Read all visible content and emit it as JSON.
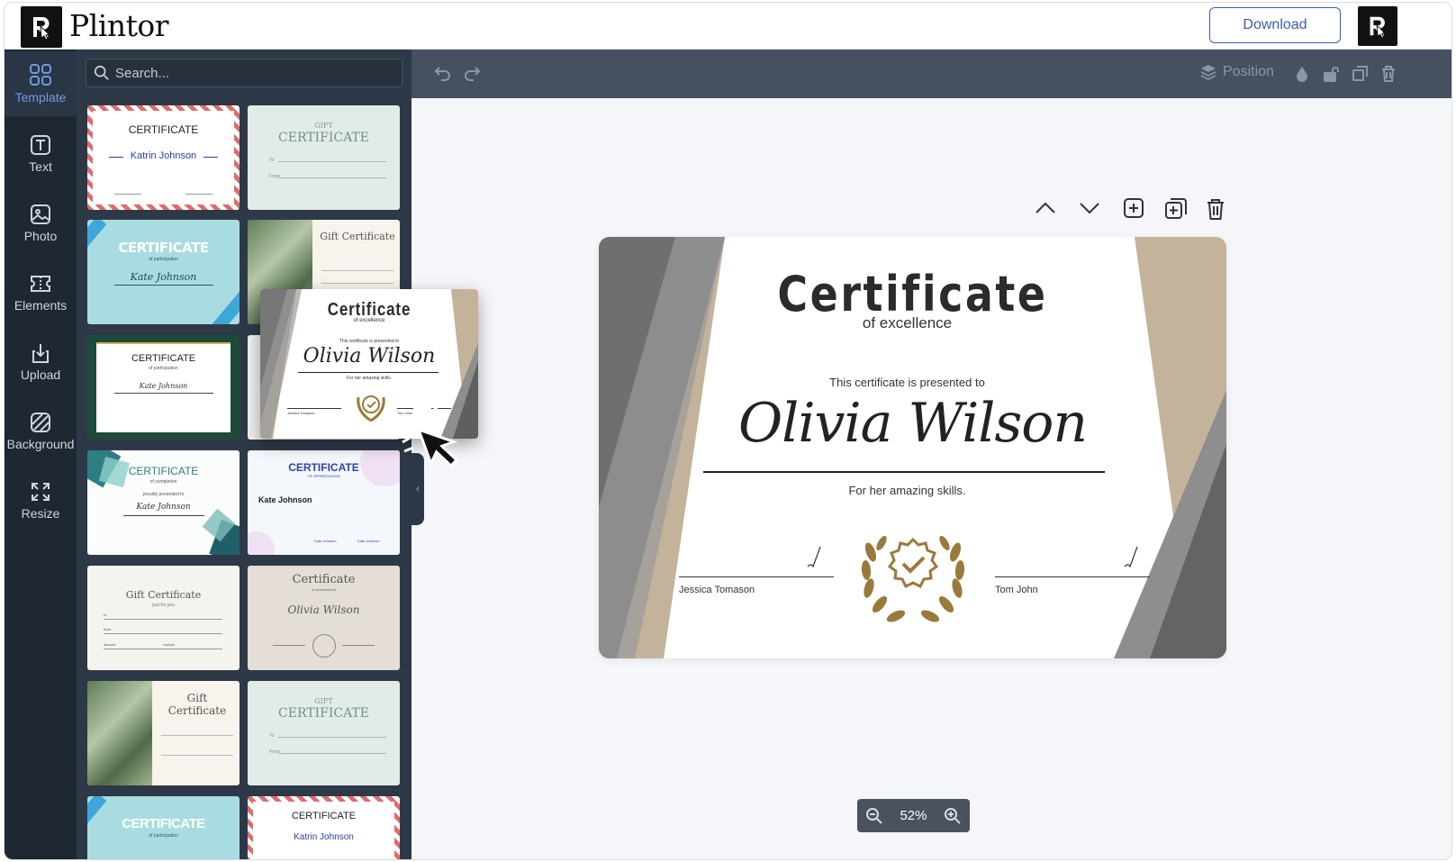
{
  "app": {
    "name": "Plintor",
    "download_label": "Download"
  },
  "sidebar": {
    "items": [
      {
        "label": "Template",
        "icon": "grid-icon",
        "active": true
      },
      {
        "label": "Text",
        "icon": "text-icon"
      },
      {
        "label": "Photo",
        "icon": "photo-icon"
      },
      {
        "label": "Elements",
        "icon": "elements-icon"
      },
      {
        "label": "Upload",
        "icon": "upload-icon"
      },
      {
        "label": "Background",
        "icon": "background-icon"
      },
      {
        "label": "Resize",
        "icon": "resize-icon"
      }
    ]
  },
  "search": {
    "placeholder": "Search..."
  },
  "templates": [
    {
      "title": "CERTIFICATE",
      "name": "Katrin Johnson"
    },
    {
      "subtitle": "GIFT",
      "title": "CERTIFICATE",
      "to": "To",
      "from": "From"
    },
    {
      "title": "CERTIFICATE",
      "subtitle": "of participation",
      "name": "Kate Johnson"
    },
    {
      "title": "Gift Certificate"
    },
    {
      "title": "CERTIFICATE",
      "subtitle": "of participation",
      "name": "Kate Johnson"
    },
    {},
    {
      "title": "CERTIFICATE",
      "subtitle": "of completion",
      "presented": "proudly presented to",
      "name": "Kate Johnson"
    },
    {
      "title": "CERTIFICATE",
      "subtitle": "OF APPRECIATION",
      "name": "Kate Johnson",
      "sign1": "Kate Johnson",
      "sign2": "Kate Johnson"
    },
    {
      "title": "Gift Certificate",
      "subtitle": "just for you",
      "to": "to",
      "from": "from",
      "amount": "amount",
      "expires": "expires"
    },
    {
      "title": "Certificate",
      "subtitle": "of achievement",
      "name": "Olivia Wilson"
    },
    {
      "title": "Gift Certificate"
    },
    {
      "subtitle": "GIFT",
      "title": "CERTIFICATE",
      "to": "To",
      "from": "From"
    },
    {
      "title": "CERTIFICATE",
      "subtitle": "of participation"
    },
    {
      "title": "CERTIFICATE",
      "name": "Katrin Johnson"
    }
  ],
  "drag_preview": {
    "title": "Certificate",
    "subtitle": "of excellence",
    "presented": "This certificate is presented to",
    "name": "Olivia Wilson",
    "reason": "For her amazing skills.",
    "sign_left": "Jessica Tomason",
    "sign_right": "Tom John"
  },
  "toolbar": {
    "position_label": "Position"
  },
  "certificate": {
    "title": "Certificate",
    "subtitle": "of excellence",
    "presented": "This certificate is presented to",
    "name": "Olivia Wilson",
    "reason": "For her amazing skills.",
    "sign_left": "Jessica Tomason",
    "sign_right": "Tom John"
  },
  "zoom": {
    "level": "52%"
  },
  "colors": {
    "accent": "#3d5bb0",
    "panel": "#2e3947",
    "rail": "#1f2733",
    "gold": "#9a7a3c",
    "taupe": "#c3b39b",
    "gray": "#5f5f5f"
  }
}
